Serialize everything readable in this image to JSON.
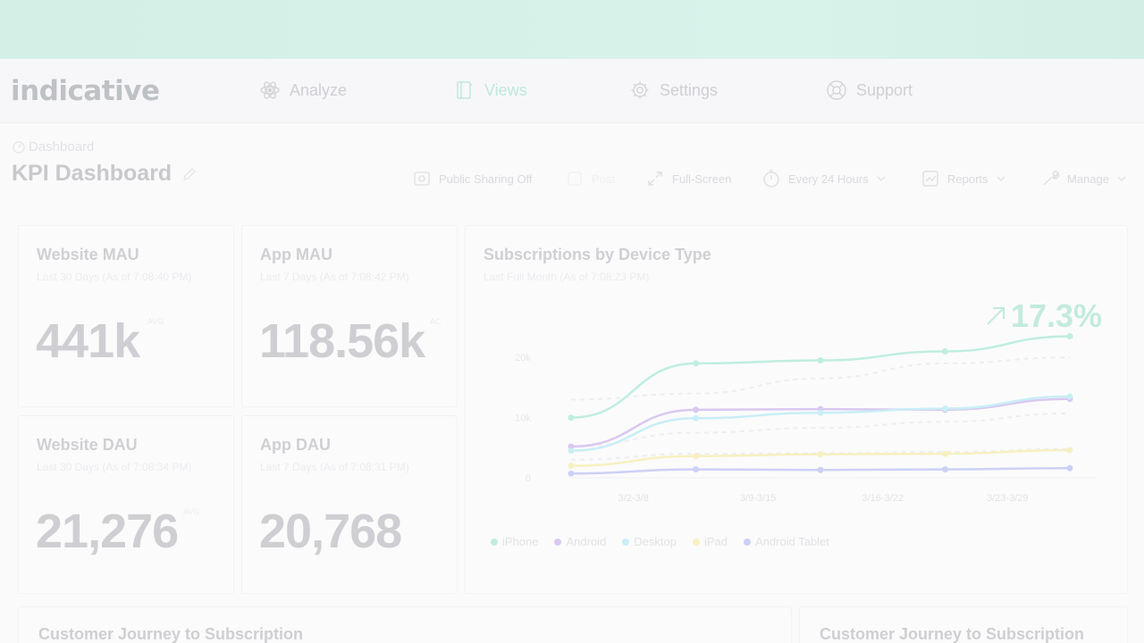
{
  "app": {
    "logo": "indicative"
  },
  "nav": {
    "items": [
      {
        "label": "Analyze",
        "icon": "atom-icon"
      },
      {
        "label": "Views",
        "icon": "book-icon"
      },
      {
        "label": "Settings",
        "icon": "gear-icon"
      },
      {
        "label": "Support",
        "icon": "lifebuoy-icon"
      }
    ]
  },
  "breadcrumb": "Dashboard",
  "page_title": "KPI Dashboard",
  "toolbar": {
    "public_sharing": "Public Sharing Off",
    "post": "Post",
    "fullscreen": "Full-Screen",
    "refresh": "Every 24 Hours",
    "reports": "Reports",
    "manage": "Manage"
  },
  "cards": {
    "website_mau": {
      "title": "Website MAU",
      "subtitle": "Last 30 Days (As of 7:08:40 PM)",
      "value": "441k",
      "tag": "AVG"
    },
    "app_mau": {
      "title": "App MAU",
      "subtitle": "Last 7 Days (As of 7:08:42 PM)",
      "value": "118.56k",
      "tag": "AC"
    },
    "website_dau": {
      "title": "Website DAU",
      "subtitle": "Last 30 Days (As of 7:08:34 PM)",
      "value": "21,276",
      "tag": "AVG"
    },
    "app_dau": {
      "title": "App DAU",
      "subtitle": "Last 7 Days (As of 7:08:31 PM)",
      "value": "20,768"
    }
  },
  "subscriptions_chart": {
    "title": "Subscriptions by Device Type",
    "subtitle": "Last Full Month (As of 7:08:23 PM)",
    "growth": "17.3%"
  },
  "bottom": {
    "left_title": "Customer Journey to Subscription",
    "right_title": "Customer Journey to Subscription"
  },
  "colors": {
    "accent": "#3fc69b",
    "iphone": "#bfeee0",
    "android": "#d9c8f0",
    "desktop": "#c9eef6",
    "ipad": "#f7f0c0",
    "android_tablet": "#cdd0f5"
  },
  "chart_data": {
    "type": "line",
    "categories": [
      "3/2-3/8",
      "3/9-3/15",
      "3/16-3/22",
      "3/23-3/29"
    ],
    "x": [
      0,
      1,
      2,
      3,
      4
    ],
    "yticks": [
      0,
      10000,
      20000
    ],
    "ytick_labels": [
      "0",
      "10k",
      "20k"
    ],
    "ylim": [
      0,
      27000
    ],
    "series": [
      {
        "name": "iPhone",
        "values": [
          10000,
          19000,
          19500,
          21000,
          23500
        ],
        "color": "#bfeee0"
      },
      {
        "name": "Android",
        "values": [
          5200,
          11300,
          11400,
          11300,
          13100
        ],
        "color": "#d9c8f0"
      },
      {
        "name": "Desktop",
        "values": [
          4500,
          9900,
          10800,
          11500,
          13500
        ],
        "color": "#c9eef6"
      },
      {
        "name": "iPad",
        "values": [
          2000,
          3600,
          3900,
          4000,
          4600
        ],
        "color": "#f7f0c0"
      },
      {
        "name": "Android Tablet",
        "values": [
          700,
          1400,
          1300,
          1400,
          1600
        ],
        "color": "#cdd0f5"
      }
    ],
    "comparison": [
      {
        "values": [
          13000,
          14000,
          16500,
          19000,
          20000
        ]
      },
      {
        "values": [
          5200,
          7500,
          8300,
          9300,
          10700
        ]
      },
      {
        "values": [
          3000,
          4000,
          4100,
          4300,
          4800
        ]
      }
    ],
    "legend": "bottom-left",
    "grid": false
  }
}
